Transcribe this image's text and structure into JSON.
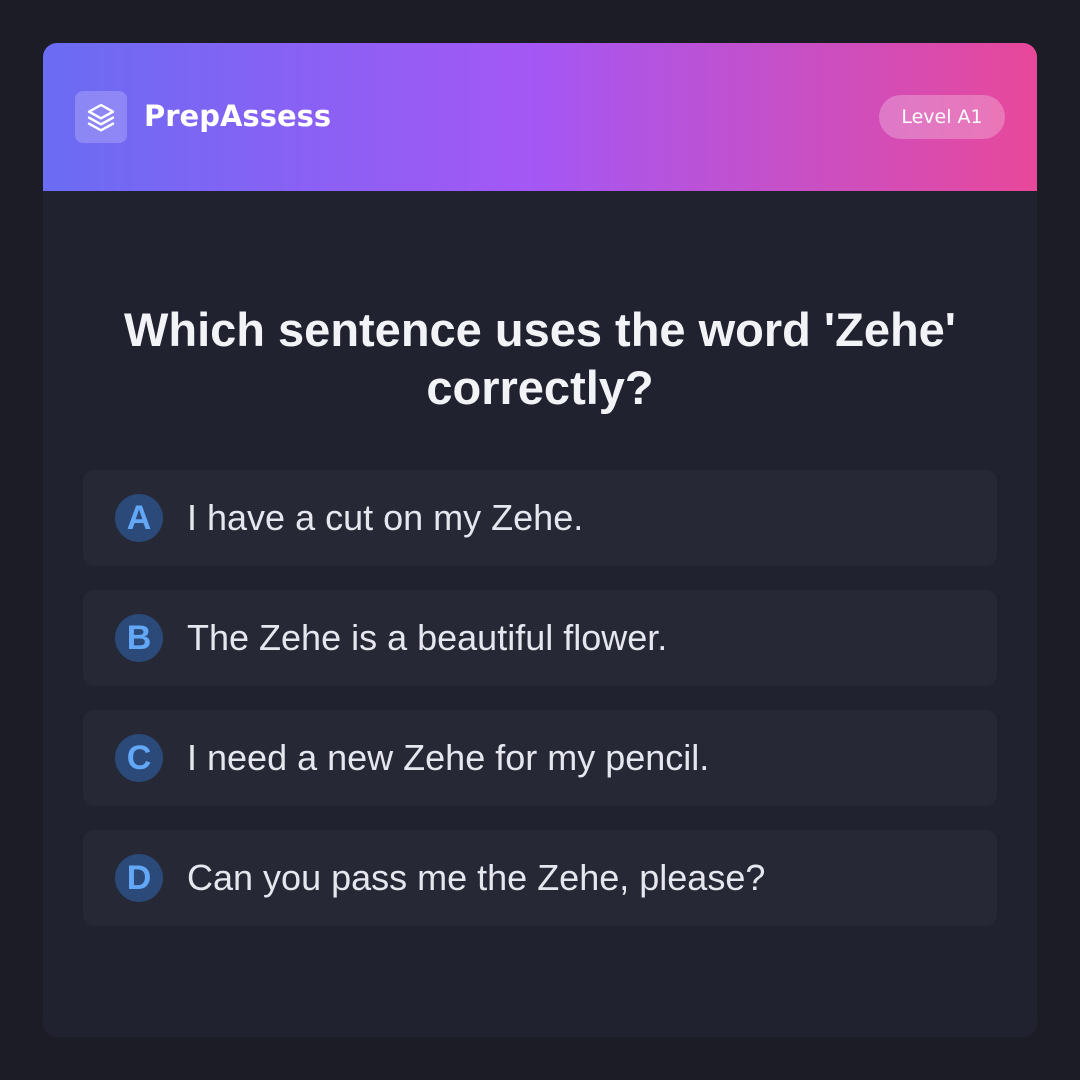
{
  "header": {
    "logo_icon": "layers-icon",
    "brand": "PrepAssess",
    "level_badge": "Level A1"
  },
  "question": "Which sentence uses the word 'Zehe' correctly?",
  "options": [
    {
      "letter": "A",
      "text": "I have a cut on my Zehe."
    },
    {
      "letter": "B",
      "text": "The Zehe is a beautiful flower."
    },
    {
      "letter": "C",
      "text": "I need a new Zehe for my pencil."
    },
    {
      "letter": "D",
      "text": "Can you pass me the Zehe, please?"
    }
  ],
  "colors": {
    "gradient_start": "#6a6cf3",
    "gradient_mid": "#a557f4",
    "gradient_end": "#e8489a",
    "background": "#1b1c26",
    "card": "#20222f",
    "option_bg": "#262836",
    "letter_circle": "#2b4a7a",
    "letter_text": "#63a7f7"
  }
}
